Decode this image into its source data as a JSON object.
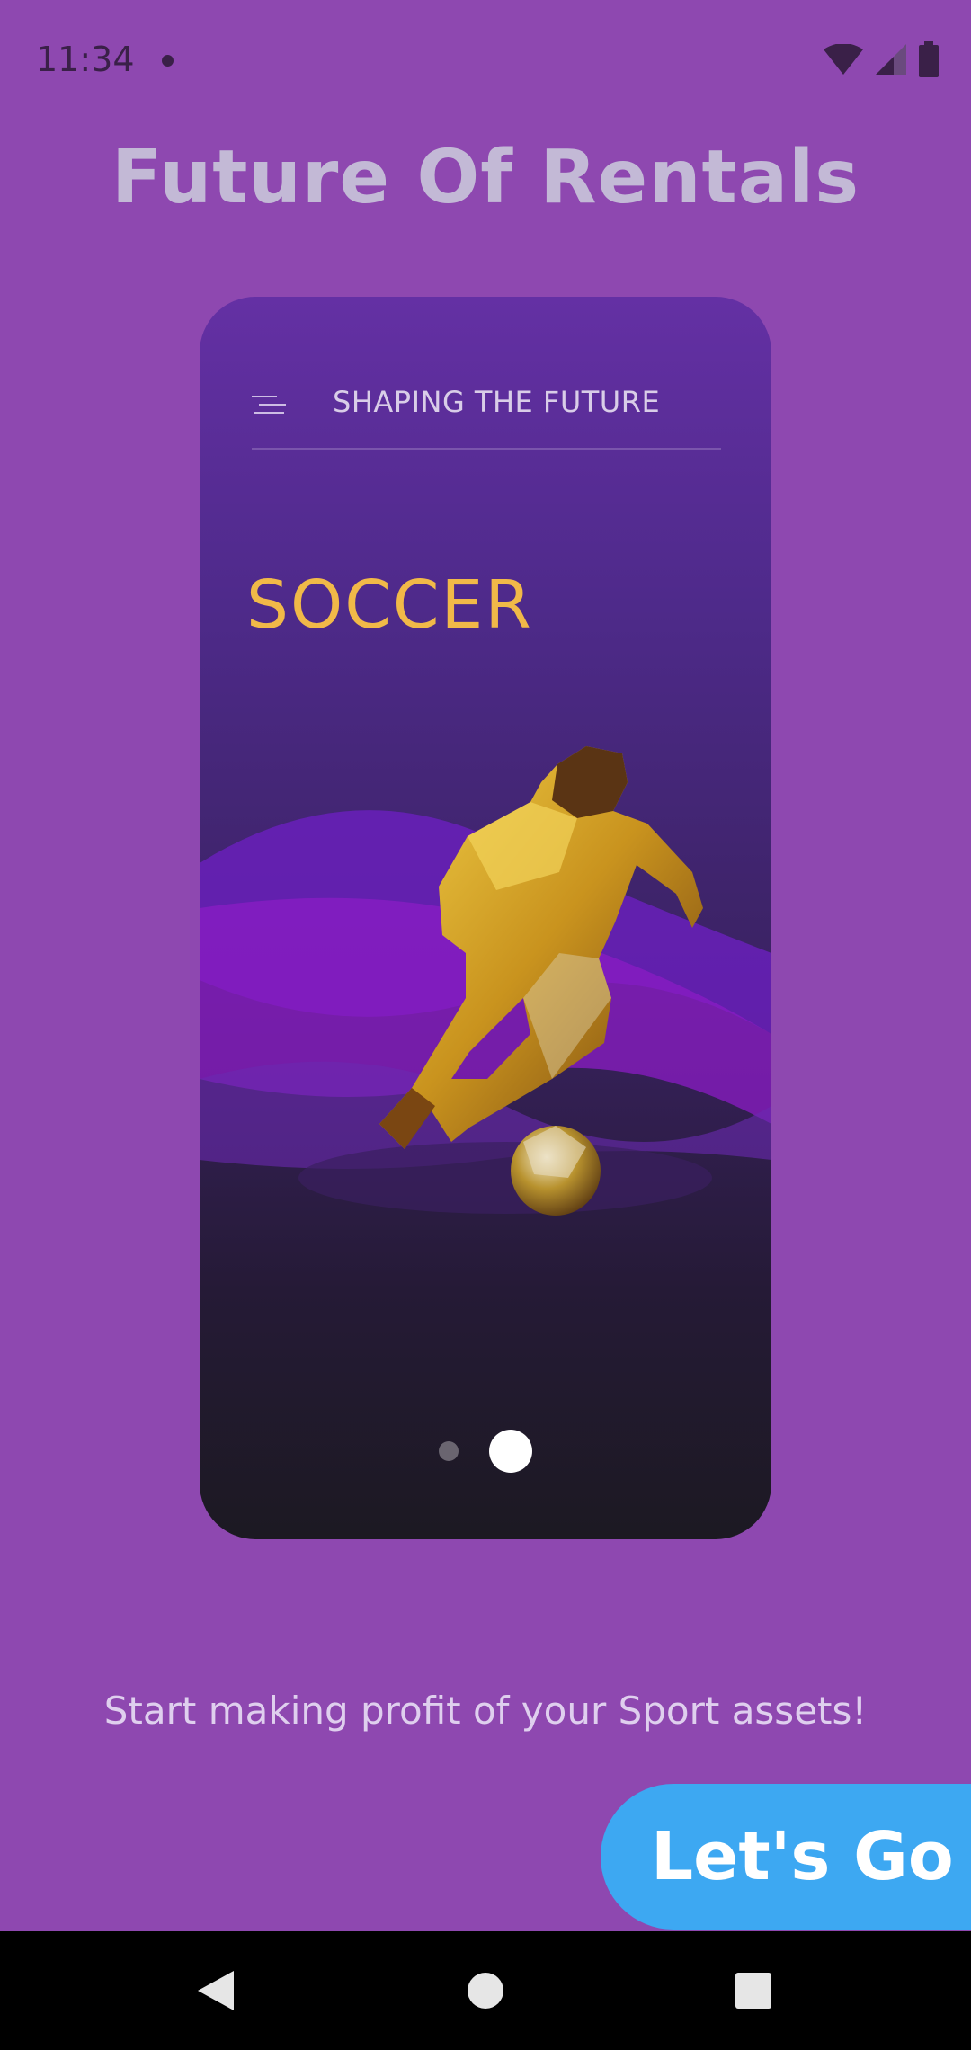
{
  "status_bar": {
    "time": "11:34"
  },
  "header": {
    "title": "Future Of Rentals"
  },
  "phone": {
    "title": "SHAPING THE FUTURE",
    "sport": "SOCCER",
    "pager": {
      "count": 2,
      "active_index": 1
    }
  },
  "tagline": "Start making profit of your Sport assets!",
  "cta": {
    "label": "Let's Go"
  },
  "colors": {
    "background": "#8e48b0",
    "headline": "#c3b9d6",
    "sport_title": "#f1b948",
    "cta": "#3da8f2"
  },
  "icons": [
    "wifi-icon",
    "signal-icon",
    "battery-icon",
    "menu-icon",
    "back-icon",
    "home-icon",
    "recents-icon"
  ]
}
